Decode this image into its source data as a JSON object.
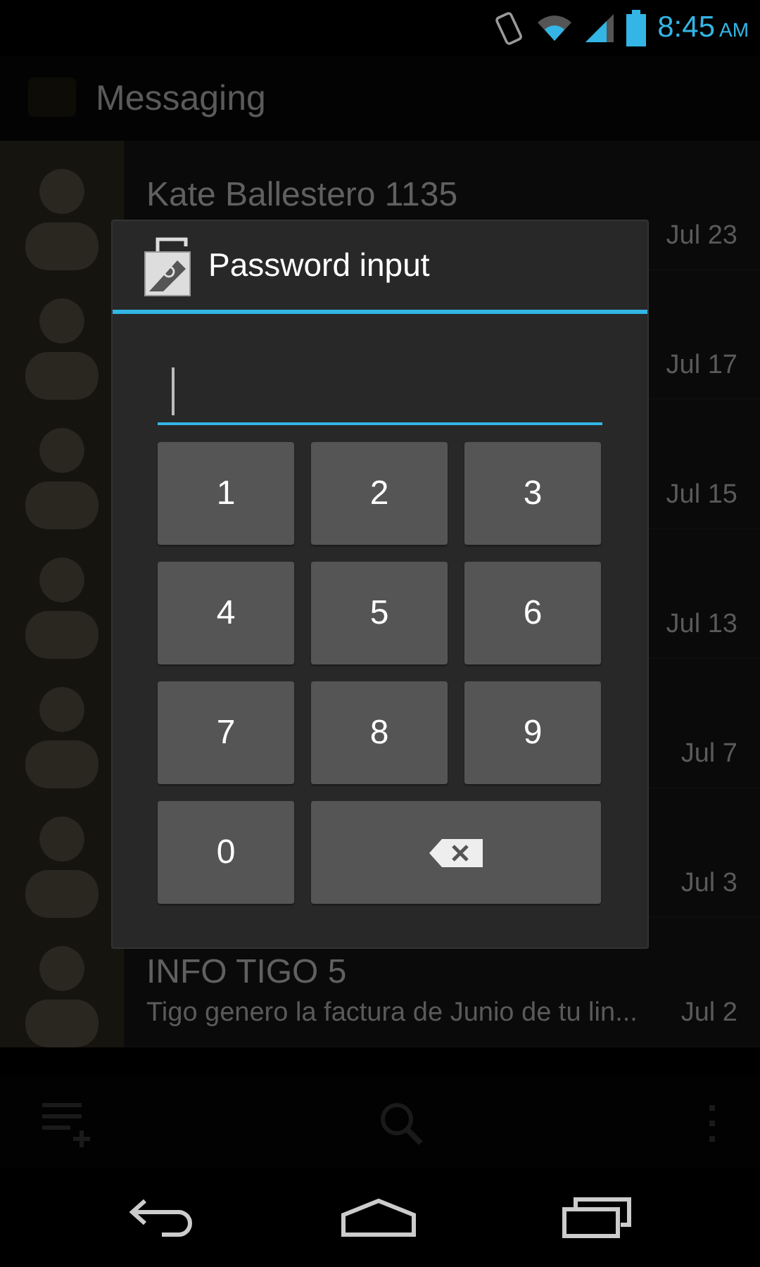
{
  "status_bar": {
    "time": "8:45",
    "meridiem": "AM"
  },
  "action_bar": {
    "title": "Messaging"
  },
  "conversations": [
    {
      "name": "Kate Ballestero 1135",
      "date": "Jul 23"
    },
    {
      "date": "Jul 17"
    },
    {
      "date": "Jul 15"
    },
    {
      "date": "Jul 13"
    },
    {
      "date": "Jul 7"
    },
    {
      "date": "Jul 3"
    },
    {
      "name": "INFO TIGO 5",
      "snippet": "Tigo genero la factura de Junio de tu lin...",
      "date": "Jul 2"
    }
  ],
  "dialog": {
    "title": "Password input",
    "keys": [
      {
        "kind": "digit",
        "label": "1"
      },
      {
        "kind": "digit",
        "label": "2"
      },
      {
        "kind": "digit",
        "label": "3"
      },
      {
        "kind": "digit",
        "label": "4"
      },
      {
        "kind": "digit",
        "label": "5"
      },
      {
        "kind": "digit",
        "label": "6"
      },
      {
        "kind": "digit",
        "label": "7"
      },
      {
        "kind": "digit",
        "label": "8"
      },
      {
        "kind": "digit",
        "label": "9"
      },
      {
        "kind": "digit",
        "label": "0"
      },
      {
        "kind": "backspace"
      }
    ]
  }
}
